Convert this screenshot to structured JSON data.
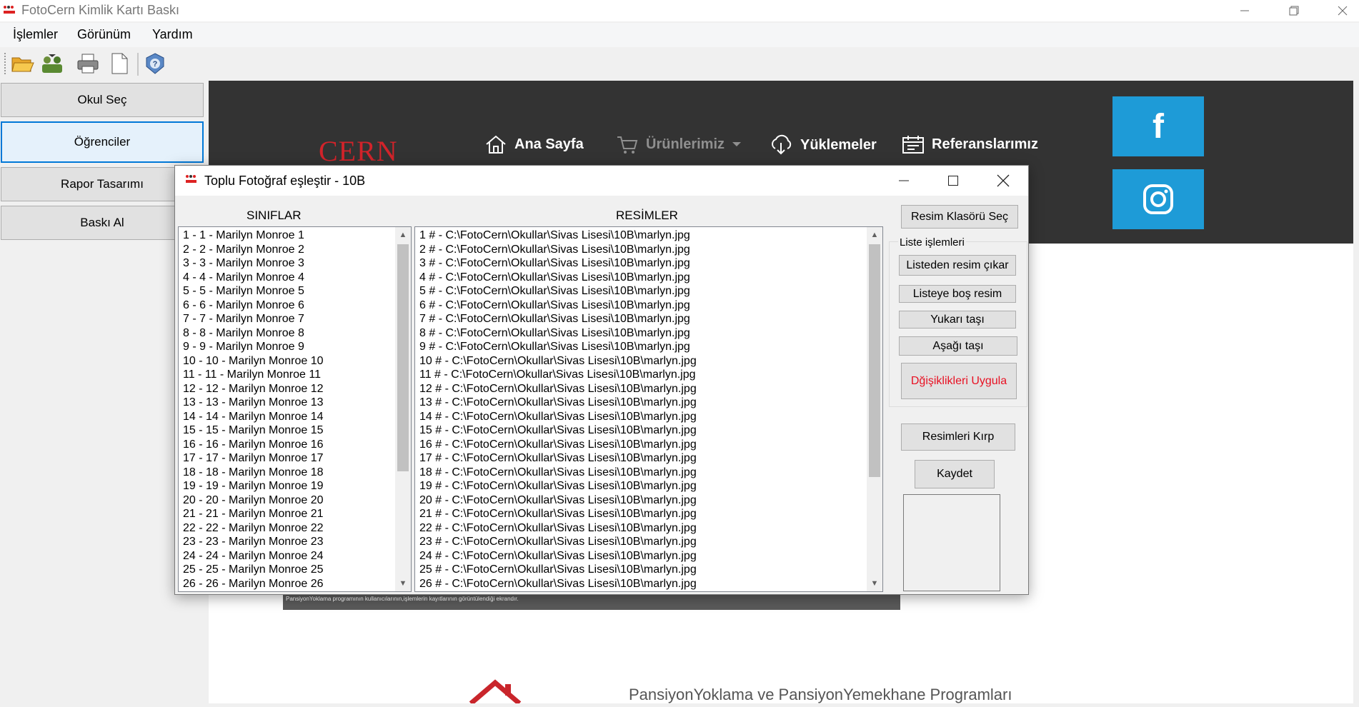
{
  "app": {
    "title": "FotoCern Kimlik Kartı Baskı",
    "logo_text": "Foto Cern"
  },
  "menu": [
    "İşlemler",
    "Görünüm",
    "Yardım"
  ],
  "toolbar": [
    "open-folder-icon",
    "students-icon",
    "print-icon",
    "new-document-icon",
    "help-icon"
  ],
  "left_panel": {
    "buttons": [
      "Okul Seç",
      "Öğrenciler",
      "Rapor Tasarımı",
      "Baskı Al"
    ]
  },
  "web": {
    "logo": "CERN",
    "nav": [
      "Ana Sayfa",
      "Ürünlerimiz",
      "Yüklemeler",
      "Referanslarımız"
    ],
    "social": [
      "f",
      "instagram"
    ],
    "strip_text": "PansiyonYoklama programının kullanıcılarının,işlemlerin kayıtlarının görüntülendiği ekrandır.",
    "footer_text": "PansiyonYoklama ve PansiyonYemekhane Programları"
  },
  "dialog": {
    "title": "Toplu Fotoğraf eşleştir - 10B",
    "siniflar_header": "SINIFLAR",
    "resimler_header": "RESİMLER",
    "siniflar": [
      "1 - 1 - Marilyn Monroe 1",
      "2 - 2 - Marilyn Monroe 2",
      "3 - 3 - Marilyn Monroe 3",
      "4 - 4 - Marilyn Monroe 4",
      "5 - 5 - Marilyn Monroe 5",
      "6 - 6 - Marilyn Monroe 6",
      "7 - 7 - Marilyn Monroe 7",
      "8 - 8 - Marilyn Monroe 8",
      "9 - 9 - Marilyn Monroe 9",
      "10 - 10 - Marilyn Monroe 10",
      "11 - 11 - Marilyn Monroe 11",
      "12 - 12 - Marilyn Monroe 12",
      "13 - 13 - Marilyn Monroe 13",
      "14 - 14 - Marilyn Monroe 14",
      "15 - 15 - Marilyn Monroe 15",
      "16 - 16 - Marilyn Monroe 16",
      "17 - 17 - Marilyn Monroe 17",
      "18 - 18 - Marilyn Monroe 18",
      "19 - 19 - Marilyn Monroe 19",
      "20 - 20 - Marilyn Monroe 20",
      "21 - 21 - Marilyn Monroe 21",
      "22 - 22 - Marilyn Monroe 22",
      "23 - 23 - Marilyn Monroe 23",
      "24 - 24 - Marilyn Monroe 24",
      "25 - 25 - Marilyn Monroe 25",
      "26 - 26 - Marilyn Monroe 26"
    ],
    "resimler": [
      "1 # - C:\\FotoCern\\Okullar\\Sivas Lisesi\\10B\\marlyn.jpg",
      "2 # - C:\\FotoCern\\Okullar\\Sivas Lisesi\\10B\\marlyn.jpg",
      "3 # - C:\\FotoCern\\Okullar\\Sivas Lisesi\\10B\\marlyn.jpg",
      "4 # - C:\\FotoCern\\Okullar\\Sivas Lisesi\\10B\\marlyn.jpg",
      "5 # - C:\\FotoCern\\Okullar\\Sivas Lisesi\\10B\\marlyn.jpg",
      "6 # - C:\\FotoCern\\Okullar\\Sivas Lisesi\\10B\\marlyn.jpg",
      "7 # - C:\\FotoCern\\Okullar\\Sivas Lisesi\\10B\\marlyn.jpg",
      "8 # - C:\\FotoCern\\Okullar\\Sivas Lisesi\\10B\\marlyn.jpg",
      "9 # - C:\\FotoCern\\Okullar\\Sivas Lisesi\\10B\\marlyn.jpg",
      "10 # - C:\\FotoCern\\Okullar\\Sivas Lisesi\\10B\\marlyn.jpg",
      "11 # - C:\\FotoCern\\Okullar\\Sivas Lisesi\\10B\\marlyn.jpg",
      "12 # - C:\\FotoCern\\Okullar\\Sivas Lisesi\\10B\\marlyn.jpg",
      "13 # - C:\\FotoCern\\Okullar\\Sivas Lisesi\\10B\\marlyn.jpg",
      "14 # - C:\\FotoCern\\Okullar\\Sivas Lisesi\\10B\\marlyn.jpg",
      "15 # - C:\\FotoCern\\Okullar\\Sivas Lisesi\\10B\\marlyn.jpg",
      "16 # - C:\\FotoCern\\Okullar\\Sivas Lisesi\\10B\\marlyn.jpg",
      "17 # - C:\\FotoCern\\Okullar\\Sivas Lisesi\\10B\\marlyn.jpg",
      "18 # - C:\\FotoCern\\Okullar\\Sivas Lisesi\\10B\\marlyn.jpg",
      "19 # - C:\\FotoCern\\Okullar\\Sivas Lisesi\\10B\\marlyn.jpg",
      "20 # - C:\\FotoCern\\Okullar\\Sivas Lisesi\\10B\\marlyn.jpg",
      "21 # - C:\\FotoCern\\Okullar\\Sivas Lisesi\\10B\\marlyn.jpg",
      "22 # - C:\\FotoCern\\Okullar\\Sivas Lisesi\\10B\\marlyn.jpg",
      "23 # - C:\\FotoCern\\Okullar\\Sivas Lisesi\\10B\\marlyn.jpg",
      "24 # - C:\\FotoCern\\Okullar\\Sivas Lisesi\\10B\\marlyn.jpg",
      "25 # - C:\\FotoCern\\Okullar\\Sivas Lisesi\\10B\\marlyn.jpg",
      "26 # - C:\\FotoCern\\Okullar\\Sivas Lisesi\\10B\\marlyn.jpg"
    ],
    "buttons": {
      "folder": "Resim Klasörü Seç",
      "group_label": "Liste işlemleri",
      "remove": "Listeden resim çıkar",
      "add_empty": "Listeye boş resim",
      "move_up": "Yukarı taşı",
      "move_down": "Aşağı taşı",
      "apply": "Dğişiklikleri Uygula",
      "crop": "Resimleri Kırp",
      "save": "Kaydet"
    },
    "apply_color": "#e81123"
  },
  "colors": {
    "web_header": "#333333",
    "social_blue": "#1e9bd7",
    "cern_red": "#d2232a"
  }
}
